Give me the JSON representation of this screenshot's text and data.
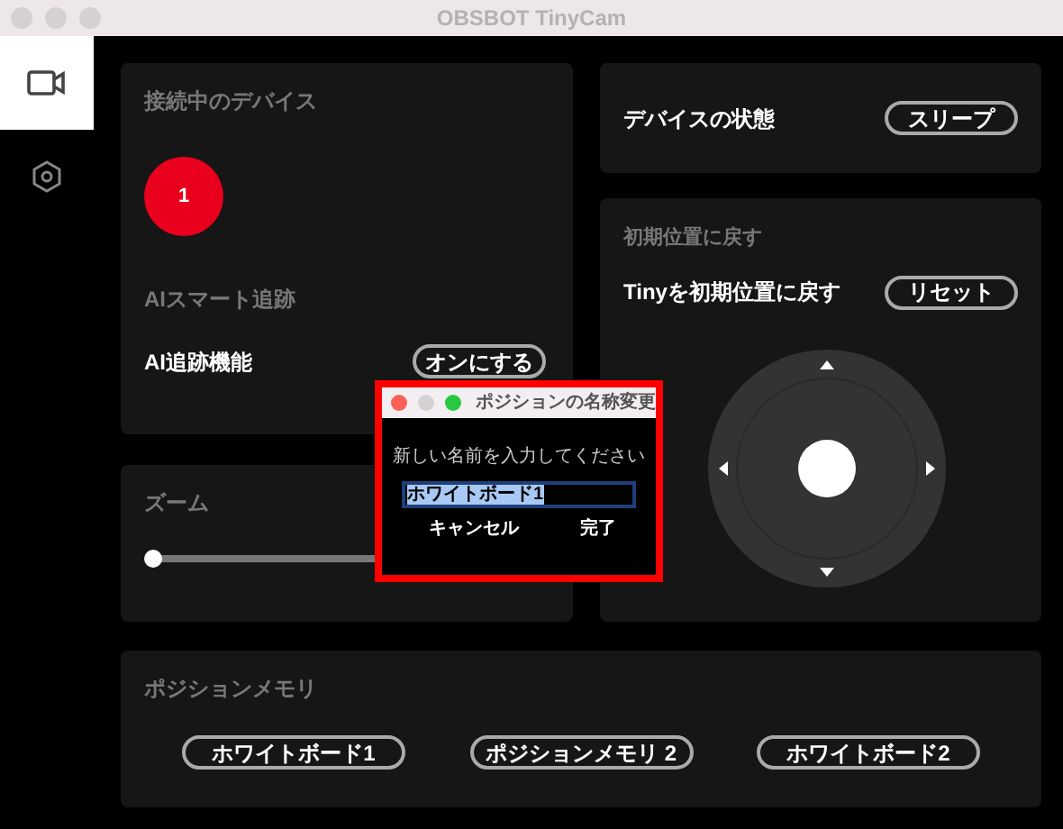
{
  "window": {
    "title": "OBSBOT TinyCam"
  },
  "sidebar": {
    "items": [
      {
        "kind": "camera",
        "selected": true
      },
      {
        "kind": "settings",
        "selected": false
      }
    ]
  },
  "connected": {
    "title": "接続中のデバイス",
    "device": "1"
  },
  "ai": {
    "title": "AIスマート追跡",
    "label": "AI追跡機能",
    "button": "オンにする"
  },
  "zoom": {
    "title": "ズーム",
    "level": 0
  },
  "status": {
    "label": "デバイスの状態",
    "button": "スリープ"
  },
  "reset": {
    "title": "初期位置に戻す",
    "label": "Tinyを初期位置に戻す",
    "button": "リセット"
  },
  "memory": {
    "title": "ポジションメモリ",
    "buttons": [
      "ホワイトボード1",
      "ポジションメモリ 2",
      "ホワイトボード2"
    ]
  },
  "dialog": {
    "title": "ポジションの名称変更",
    "prompt": "新しい名前を入力してください",
    "value": "ホワイトボード1",
    "buttons": [
      "キャンセル",
      "完了"
    ]
  }
}
